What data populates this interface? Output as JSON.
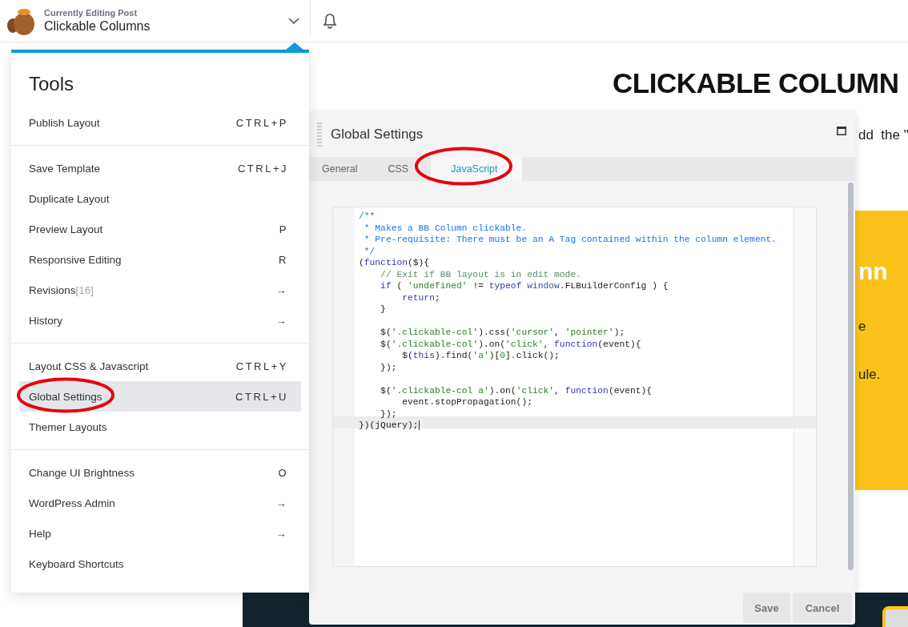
{
  "top_bar": {
    "caption": "Currently Editing Post",
    "title": "Clickable Columns"
  },
  "page": {
    "heading": "CLICKABLE COLUMN",
    "intro_fragment": "dd  the \"",
    "yellow_fragments": [
      {
        "kind": "heading",
        "text": "nn"
      },
      {
        "kind": "body",
        "text": "e"
      },
      {
        "kind": "body",
        "text": "ule."
      }
    ]
  },
  "tools_menu": {
    "title": "Tools",
    "groups": [
      {
        "items": [
          {
            "label": "Publish Layout",
            "shortcut": "CTRL+P",
            "selected": false
          }
        ]
      },
      {
        "items": [
          {
            "label": "Save Template",
            "shortcut": "CTRL+J",
            "selected": false
          },
          {
            "label": "Duplicate Layout",
            "selected": false
          },
          {
            "label": "Preview Layout",
            "shortcut": "P",
            "selected": false
          },
          {
            "label": "Responsive Editing",
            "shortcut": "R",
            "selected": false
          },
          {
            "label": "Revisions",
            "count": "[16]",
            "shortcut": "→",
            "selected": false
          },
          {
            "label": "History",
            "shortcut": "→",
            "selected": false
          }
        ]
      },
      {
        "items": [
          {
            "label": "Layout CSS & Javascript",
            "shortcut": "CTRL+Y",
            "selected": false
          },
          {
            "label": "Global Settings",
            "shortcut": "CTRL+U",
            "selected": true
          },
          {
            "label": "Themer Layouts",
            "selected": false
          }
        ]
      },
      {
        "items": [
          {
            "label": "Change UI Brightness",
            "shortcut": "O",
            "selected": false
          },
          {
            "label": "WordPress Admin",
            "shortcut": "→",
            "selected": false
          },
          {
            "label": "Help",
            "shortcut": "→",
            "selected": false
          },
          {
            "label": "Keyboard Shortcuts",
            "selected": false
          }
        ]
      }
    ]
  },
  "settings_dialog": {
    "title": "Global Settings",
    "tabs": [
      {
        "label": "General",
        "selected": false
      },
      {
        "label": "CSS",
        "selected": false
      },
      {
        "label": "JavaScript",
        "selected": true
      }
    ],
    "code_lines": [
      {
        "kind": "code",
        "active": false,
        "segments": [
          {
            "kind": "doc",
            "t": "/**"
          }
        ]
      },
      {
        "kind": "code",
        "active": false,
        "segments": [
          {
            "kind": "doc",
            "t": " * Makes a BB Column clickable."
          }
        ]
      },
      {
        "kind": "code",
        "active": false,
        "segments": [
          {
            "kind": "doc",
            "t": " * Pre-requisite: There must be an A Tag contained within the column element."
          }
        ]
      },
      {
        "kind": "code",
        "active": false,
        "segments": [
          {
            "kind": "doc",
            "t": " */"
          }
        ]
      },
      {
        "kind": "code",
        "active": false,
        "segments": [
          {
            "kind": "plain",
            "t": "("
          },
          {
            "kind": "kw",
            "t": "function"
          },
          {
            "kind": "plain",
            "t": "($){"
          }
        ]
      },
      {
        "kind": "code",
        "active": false,
        "segments": [
          {
            "kind": "comment",
            "t": "    // Exit if BB layout is in edit mode."
          }
        ]
      },
      {
        "kind": "code",
        "active": false,
        "segments": [
          {
            "kind": "kw",
            "t": "    if"
          },
          {
            "kind": "plain",
            "t": " ( "
          },
          {
            "kind": "str",
            "t": "'undefined'"
          },
          {
            "kind": "plain",
            "t": " != "
          },
          {
            "kind": "kw",
            "t": "typeof"
          },
          {
            "kind": "var",
            "t": " window"
          },
          {
            "kind": "plain",
            "t": ".FLBuilderConfig ) {"
          }
        ]
      },
      {
        "kind": "code",
        "active": false,
        "segments": [
          {
            "kind": "kw",
            "t": "        return"
          },
          {
            "kind": "plain",
            "t": ";"
          }
        ]
      },
      {
        "kind": "code",
        "active": false,
        "segments": [
          {
            "kind": "plain",
            "t": "    }"
          }
        ]
      },
      {
        "kind": "blank",
        "active": false
      },
      {
        "kind": "code",
        "active": false,
        "segments": [
          {
            "kind": "plain",
            "t": "    $("
          },
          {
            "kind": "str",
            "t": "'.clickable-col'"
          },
          {
            "kind": "plain",
            "t": ").css("
          },
          {
            "kind": "str",
            "t": "'cursor'"
          },
          {
            "kind": "plain",
            "t": ", "
          },
          {
            "kind": "str",
            "t": "'pointer'"
          },
          {
            "kind": "plain",
            "t": ");"
          }
        ]
      },
      {
        "kind": "code",
        "active": false,
        "segments": [
          {
            "kind": "plain",
            "t": "    $("
          },
          {
            "kind": "str",
            "t": "'.clickable-col'"
          },
          {
            "kind": "plain",
            "t": ").on("
          },
          {
            "kind": "str",
            "t": "'click'"
          },
          {
            "kind": "plain",
            "t": ", "
          },
          {
            "kind": "kw",
            "t": "function"
          },
          {
            "kind": "plain",
            "t": "(event){"
          }
        ]
      },
      {
        "kind": "code",
        "active": false,
        "segments": [
          {
            "kind": "plain",
            "t": "        $("
          },
          {
            "kind": "kw",
            "t": "this"
          },
          {
            "kind": "plain",
            "t": ").find("
          },
          {
            "kind": "str",
            "t": "'a'"
          },
          {
            "kind": "plain",
            "t": ")["
          },
          {
            "kind": "num",
            "t": "0"
          },
          {
            "kind": "plain",
            "t": "].click();"
          }
        ]
      },
      {
        "kind": "code",
        "active": false,
        "segments": [
          {
            "kind": "plain",
            "t": "    });"
          }
        ]
      },
      {
        "kind": "blank",
        "active": false
      },
      {
        "kind": "code",
        "active": false,
        "segments": [
          {
            "kind": "plain",
            "t": "    $("
          },
          {
            "kind": "str",
            "t": "'.clickable-col a'"
          },
          {
            "kind": "plain",
            "t": ").on("
          },
          {
            "kind": "str",
            "t": "'click'"
          },
          {
            "kind": "plain",
            "t": ", "
          },
          {
            "kind": "kw",
            "t": "function"
          },
          {
            "kind": "plain",
            "t": "(event){"
          }
        ]
      },
      {
        "kind": "code",
        "active": false,
        "segments": [
          {
            "kind": "plain",
            "t": "        event.stopPropagation();"
          }
        ]
      },
      {
        "kind": "code",
        "active": false,
        "segments": [
          {
            "kind": "plain",
            "t": "    });"
          }
        ]
      },
      {
        "kind": "code",
        "active": true,
        "segments": [
          {
            "kind": "plain",
            "t": "})(jQuery);"
          }
        ]
      }
    ],
    "buttons": [
      {
        "kind": "save",
        "label": "Save"
      },
      {
        "kind": "cancel",
        "label": "Cancel"
      }
    ]
  }
}
